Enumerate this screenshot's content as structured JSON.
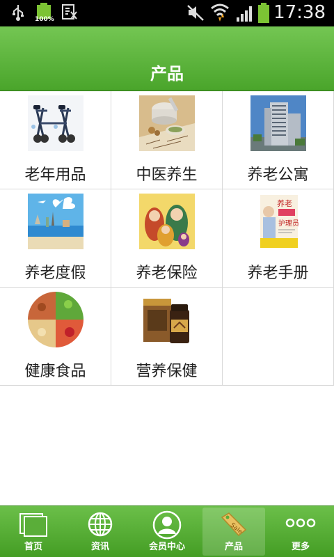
{
  "status_bar": {
    "time": "17:38",
    "battery_percent": "100%",
    "icons": [
      "usb-icon",
      "battery-charged-icon",
      "screenshot-icon",
      "mute-icon",
      "wifi-icon",
      "signal-icon",
      "battery-icon"
    ]
  },
  "header": {
    "title": "产品"
  },
  "products": [
    {
      "label": "老年用品",
      "icon": "walker-image"
    },
    {
      "label": "中医养生",
      "icon": "herbal-medicine-image"
    },
    {
      "label": "养老公寓",
      "icon": "apartment-building-image"
    },
    {
      "label": "养老度假",
      "icon": "vacation-image"
    },
    {
      "label": "养老保险",
      "icon": "nesting-dolls-image"
    },
    {
      "label": "养老手册",
      "icon": "handbook-image"
    },
    {
      "label": "健康食品",
      "icon": "healthy-food-image"
    },
    {
      "label": "营养保健",
      "icon": "supplement-box-image"
    }
  ],
  "bottom_nav": {
    "items": [
      {
        "label": "首页",
        "icon": "home-icon"
      },
      {
        "label": "资讯",
        "icon": "globe-icon"
      },
      {
        "label": "会员中心",
        "icon": "member-icon"
      },
      {
        "label": "产品",
        "icon": "sale-tag-icon",
        "active": true
      },
      {
        "label": "更多",
        "icon": "more-icon"
      }
    ]
  },
  "colors": {
    "accent_green": "#4aa52b",
    "grid_line": "#d8d8d8"
  }
}
